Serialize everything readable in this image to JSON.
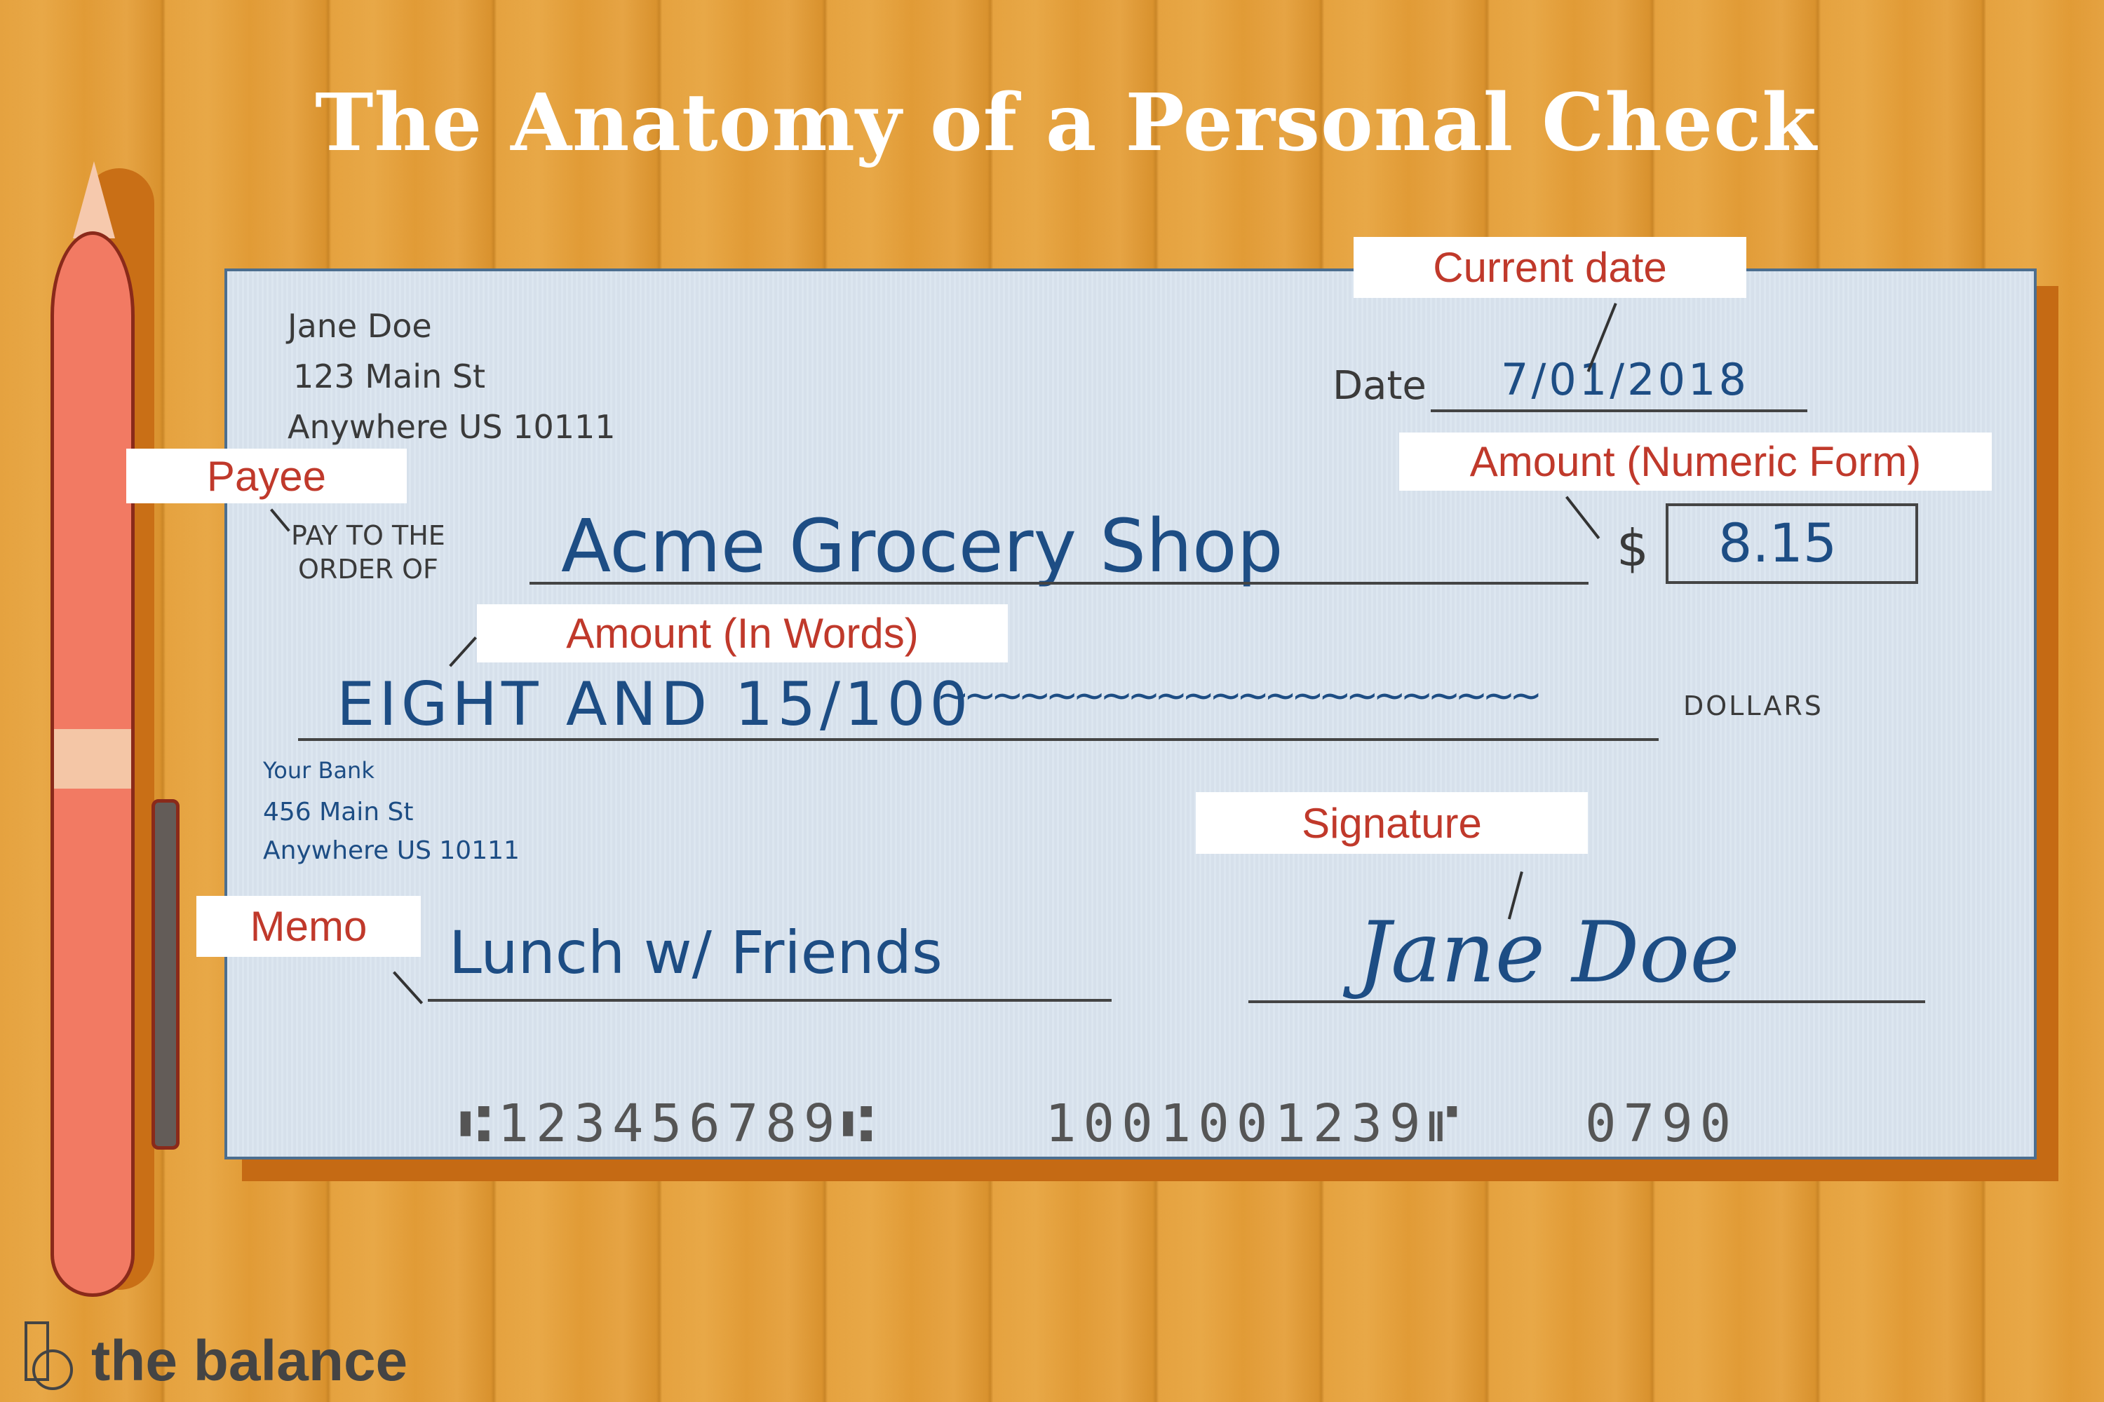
{
  "title": "The Anatomy of a Personal Check",
  "check": {
    "account_holder": {
      "name": "Jane Doe",
      "street": "123 Main St",
      "city_line": "Anywhere US 10111"
    },
    "date_label": "Date",
    "date_value": "7/01/2018",
    "pay_to_label_line1": "PAY TO THE",
    "pay_to_label_line2": "ORDER OF",
    "payee_value": "Acme Grocery Shop",
    "currency_symbol": "$",
    "amount_numeric": "8.15",
    "amount_words": "EIGHT AND 15/100",
    "amount_words_fill": "~~~~~~~~~~~~~~~~~~~~~~",
    "dollars_label": "DOLLARS",
    "bank": {
      "name": "Your Bank",
      "street": "456 Main St",
      "city_line": "Anywhere US 10111"
    },
    "memo_value": "Lunch w/ Friends",
    "signature_value": "Jane Doe",
    "micr": {
      "routing": "⑆123456789⑆",
      "account": "1001001239⑈",
      "check_number": "0790"
    }
  },
  "annotations": {
    "current_date": "Current date",
    "payee": "Payee",
    "amount_numeric": "Amount (Numeric Form)",
    "amount_words": "Amount (In Words)",
    "signature": "Signature",
    "memo": "Memo"
  },
  "brand": {
    "logo_text": "the balance"
  },
  "colors": {
    "background_wood": "#e5a23f",
    "check_paper": "#d9e4ef",
    "check_border": "#4c6e8f",
    "label_text": "#c0392b",
    "handwriting_blue": "#1d4d84",
    "pen_body": "#f27a63"
  }
}
